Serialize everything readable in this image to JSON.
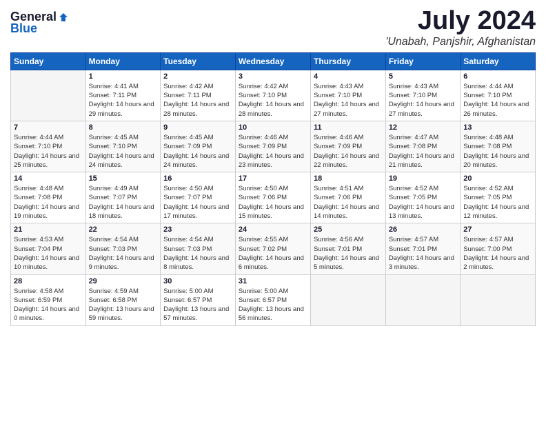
{
  "header": {
    "logo_general": "General",
    "logo_blue": "Blue",
    "month": "July 2024",
    "location": "'Unabah, Panjshir, Afghanistan"
  },
  "weekdays": [
    "Sunday",
    "Monday",
    "Tuesday",
    "Wednesday",
    "Thursday",
    "Friday",
    "Saturday"
  ],
  "weeks": [
    [
      {
        "day": "",
        "sunrise": "",
        "sunset": "",
        "daylight": ""
      },
      {
        "day": "1",
        "sunrise": "Sunrise: 4:41 AM",
        "sunset": "Sunset: 7:11 PM",
        "daylight": "Daylight: 14 hours and 29 minutes."
      },
      {
        "day": "2",
        "sunrise": "Sunrise: 4:42 AM",
        "sunset": "Sunset: 7:11 PM",
        "daylight": "Daylight: 14 hours and 28 minutes."
      },
      {
        "day": "3",
        "sunrise": "Sunrise: 4:42 AM",
        "sunset": "Sunset: 7:10 PM",
        "daylight": "Daylight: 14 hours and 28 minutes."
      },
      {
        "day": "4",
        "sunrise": "Sunrise: 4:43 AM",
        "sunset": "Sunset: 7:10 PM",
        "daylight": "Daylight: 14 hours and 27 minutes."
      },
      {
        "day": "5",
        "sunrise": "Sunrise: 4:43 AM",
        "sunset": "Sunset: 7:10 PM",
        "daylight": "Daylight: 14 hours and 27 minutes."
      },
      {
        "day": "6",
        "sunrise": "Sunrise: 4:44 AM",
        "sunset": "Sunset: 7:10 PM",
        "daylight": "Daylight: 14 hours and 26 minutes."
      }
    ],
    [
      {
        "day": "7",
        "sunrise": "Sunrise: 4:44 AM",
        "sunset": "Sunset: 7:10 PM",
        "daylight": "Daylight: 14 hours and 25 minutes."
      },
      {
        "day": "8",
        "sunrise": "Sunrise: 4:45 AM",
        "sunset": "Sunset: 7:10 PM",
        "daylight": "Daylight: 14 hours and 24 minutes."
      },
      {
        "day": "9",
        "sunrise": "Sunrise: 4:45 AM",
        "sunset": "Sunset: 7:09 PM",
        "daylight": "Daylight: 14 hours and 24 minutes."
      },
      {
        "day": "10",
        "sunrise": "Sunrise: 4:46 AM",
        "sunset": "Sunset: 7:09 PM",
        "daylight": "Daylight: 14 hours and 23 minutes."
      },
      {
        "day": "11",
        "sunrise": "Sunrise: 4:46 AM",
        "sunset": "Sunset: 7:09 PM",
        "daylight": "Daylight: 14 hours and 22 minutes."
      },
      {
        "day": "12",
        "sunrise": "Sunrise: 4:47 AM",
        "sunset": "Sunset: 7:08 PM",
        "daylight": "Daylight: 14 hours and 21 minutes."
      },
      {
        "day": "13",
        "sunrise": "Sunrise: 4:48 AM",
        "sunset": "Sunset: 7:08 PM",
        "daylight": "Daylight: 14 hours and 20 minutes."
      }
    ],
    [
      {
        "day": "14",
        "sunrise": "Sunrise: 4:48 AM",
        "sunset": "Sunset: 7:08 PM",
        "daylight": "Daylight: 14 hours and 19 minutes."
      },
      {
        "day": "15",
        "sunrise": "Sunrise: 4:49 AM",
        "sunset": "Sunset: 7:07 PM",
        "daylight": "Daylight: 14 hours and 18 minutes."
      },
      {
        "day": "16",
        "sunrise": "Sunrise: 4:50 AM",
        "sunset": "Sunset: 7:07 PM",
        "daylight": "Daylight: 14 hours and 17 minutes."
      },
      {
        "day": "17",
        "sunrise": "Sunrise: 4:50 AM",
        "sunset": "Sunset: 7:06 PM",
        "daylight": "Daylight: 14 hours and 15 minutes."
      },
      {
        "day": "18",
        "sunrise": "Sunrise: 4:51 AM",
        "sunset": "Sunset: 7:06 PM",
        "daylight": "Daylight: 14 hours and 14 minutes."
      },
      {
        "day": "19",
        "sunrise": "Sunrise: 4:52 AM",
        "sunset": "Sunset: 7:05 PM",
        "daylight": "Daylight: 14 hours and 13 minutes."
      },
      {
        "day": "20",
        "sunrise": "Sunrise: 4:52 AM",
        "sunset": "Sunset: 7:05 PM",
        "daylight": "Daylight: 14 hours and 12 minutes."
      }
    ],
    [
      {
        "day": "21",
        "sunrise": "Sunrise: 4:53 AM",
        "sunset": "Sunset: 7:04 PM",
        "daylight": "Daylight: 14 hours and 10 minutes."
      },
      {
        "day": "22",
        "sunrise": "Sunrise: 4:54 AM",
        "sunset": "Sunset: 7:03 PM",
        "daylight": "Daylight: 14 hours and 9 minutes."
      },
      {
        "day": "23",
        "sunrise": "Sunrise: 4:54 AM",
        "sunset": "Sunset: 7:03 PM",
        "daylight": "Daylight: 14 hours and 8 minutes."
      },
      {
        "day": "24",
        "sunrise": "Sunrise: 4:55 AM",
        "sunset": "Sunset: 7:02 PM",
        "daylight": "Daylight: 14 hours and 6 minutes."
      },
      {
        "day": "25",
        "sunrise": "Sunrise: 4:56 AM",
        "sunset": "Sunset: 7:01 PM",
        "daylight": "Daylight: 14 hours and 5 minutes."
      },
      {
        "day": "26",
        "sunrise": "Sunrise: 4:57 AM",
        "sunset": "Sunset: 7:01 PM",
        "daylight": "Daylight: 14 hours and 3 minutes."
      },
      {
        "day": "27",
        "sunrise": "Sunrise: 4:57 AM",
        "sunset": "Sunset: 7:00 PM",
        "daylight": "Daylight: 14 hours and 2 minutes."
      }
    ],
    [
      {
        "day": "28",
        "sunrise": "Sunrise: 4:58 AM",
        "sunset": "Sunset: 6:59 PM",
        "daylight": "Daylight: 14 hours and 0 minutes."
      },
      {
        "day": "29",
        "sunrise": "Sunrise: 4:59 AM",
        "sunset": "Sunset: 6:58 PM",
        "daylight": "Daylight: 13 hours and 59 minutes."
      },
      {
        "day": "30",
        "sunrise": "Sunrise: 5:00 AM",
        "sunset": "Sunset: 6:57 PM",
        "daylight": "Daylight: 13 hours and 57 minutes."
      },
      {
        "day": "31",
        "sunrise": "Sunrise: 5:00 AM",
        "sunset": "Sunset: 6:57 PM",
        "daylight": "Daylight: 13 hours and 56 minutes."
      },
      {
        "day": "",
        "sunrise": "",
        "sunset": "",
        "daylight": ""
      },
      {
        "day": "",
        "sunrise": "",
        "sunset": "",
        "daylight": ""
      },
      {
        "day": "",
        "sunrise": "",
        "sunset": "",
        "daylight": ""
      }
    ]
  ]
}
